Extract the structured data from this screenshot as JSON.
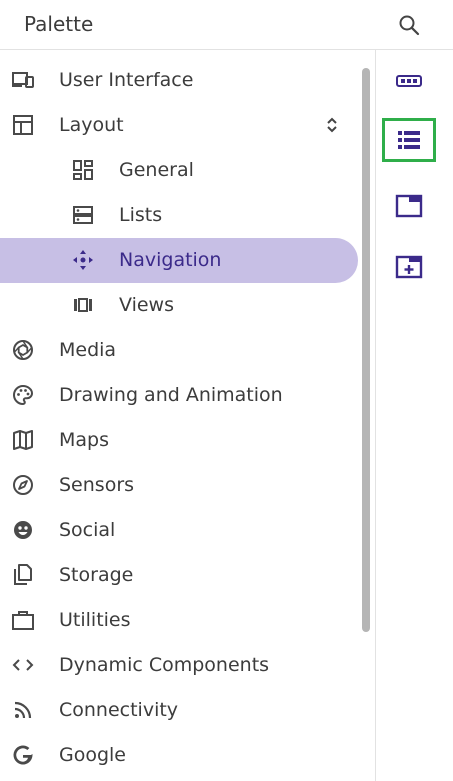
{
  "palette": {
    "title": "Palette",
    "items": [
      {
        "label": "User Interface"
      },
      {
        "label": "Layout"
      },
      {
        "label": "General"
      },
      {
        "label": "Lists"
      },
      {
        "label": "Navigation"
      },
      {
        "label": "Views"
      },
      {
        "label": "Media"
      },
      {
        "label": "Drawing and Animation"
      },
      {
        "label": "Maps"
      },
      {
        "label": "Sensors"
      },
      {
        "label": "Social"
      },
      {
        "label": "Storage"
      },
      {
        "label": "Utilities"
      },
      {
        "label": "Dynamic Components"
      },
      {
        "label": "Connectivity"
      },
      {
        "label": "Google"
      }
    ]
  },
  "colors": {
    "accent": "#3b2a8a",
    "selected_bg": "#c7bfe5",
    "focus_outline": "#2fae4a",
    "icon_gray": "#4a4a4a"
  },
  "rail": {
    "buttons": [
      {
        "icon": "horizontal-arrangement-icon"
      },
      {
        "icon": "list-view-icon"
      },
      {
        "icon": "window-icon"
      },
      {
        "icon": "add-screen-icon"
      }
    ]
  }
}
